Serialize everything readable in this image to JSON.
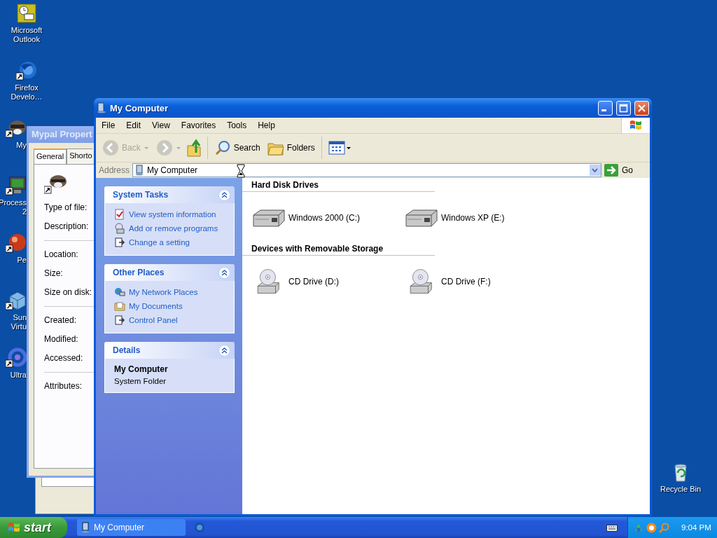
{
  "desktop_icons": [
    {
      "lines": [
        "Microsoft",
        "Outlook"
      ]
    },
    {
      "lines": [
        "Firefox",
        "Develo…"
      ]
    },
    {
      "lines": [
        "My"
      ]
    },
    {
      "lines": [
        "Process",
        "2"
      ]
    },
    {
      "lines": [
        "Pe"
      ]
    },
    {
      "lines": [
        "Sun",
        "Virtu"
      ]
    },
    {
      "lines": [
        "Ultra"
      ]
    }
  ],
  "recycle_bin": {
    "label": "Recycle Bin"
  },
  "properties_window": {
    "title": "Mypal Propert",
    "tabs": [
      {
        "label": "General",
        "selected": true
      },
      {
        "label": "Shorto",
        "selected": false
      }
    ],
    "field_groups": [
      [
        "Type of file:",
        "Description:"
      ],
      [
        "Location:",
        "Size:",
        "Size on disk:"
      ],
      [
        "Created:",
        "Modified:",
        "Accessed:"
      ],
      [
        "Attributes:"
      ]
    ]
  },
  "explorer_window": {
    "title": "My Computer",
    "menu": [
      "File",
      "Edit",
      "View",
      "Favorites",
      "Tools",
      "Help"
    ],
    "toolbar": {
      "back": {
        "label": "Back",
        "disabled": true
      },
      "forward": {
        "disabled": true
      },
      "search": "Search",
      "folders": "Folders"
    },
    "address": {
      "label": "Address",
      "value": "My Computer",
      "go": "Go"
    },
    "task_panels": [
      {
        "kind": "links",
        "title": "System Tasks",
        "expanded": true,
        "items": [
          {
            "label": "View system information",
            "kind": "info"
          },
          {
            "label": "Add or remove programs",
            "kind": "programs"
          },
          {
            "label": "Change a setting",
            "kind": "setting"
          }
        ]
      },
      {
        "kind": "links",
        "title": "Other Places",
        "expanded": true,
        "items": [
          {
            "label": "My Network Places",
            "kind": "network"
          },
          {
            "label": "My Documents",
            "kind": "documents"
          },
          {
            "label": "Control Panel",
            "kind": "setting"
          }
        ]
      },
      {
        "kind": "details",
        "title": "Details",
        "expanded": true,
        "name": "My Computer",
        "description": "System Folder"
      }
    ],
    "groups": [
      {
        "title": "Hard Disk Drives",
        "items": [
          {
            "label": "Windows 2000 (C:)",
            "kind": "hdd"
          },
          {
            "label": "Windows XP (E:)",
            "kind": "hdd"
          }
        ]
      },
      {
        "title": "Devices with Removable Storage",
        "items": [
          {
            "label": "CD Drive (D:)",
            "kind": "cd"
          },
          {
            "label": "CD Drive (F:)",
            "kind": "cd"
          }
        ]
      }
    ]
  },
  "taskbar": {
    "start": "start",
    "tasks": [
      {
        "label": "My Computer",
        "selected": false
      }
    ],
    "clock": "9:04 PM"
  }
}
